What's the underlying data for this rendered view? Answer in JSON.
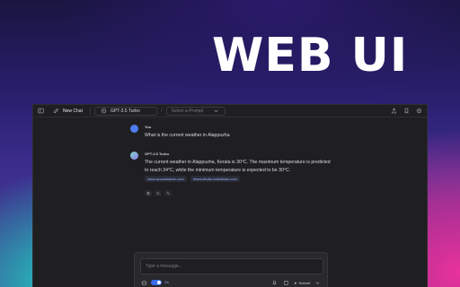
{
  "hero": {
    "title": "WEB UI"
  },
  "toolbar": {
    "new_chat_label": "New Chat",
    "model_label": "GPT-3.5 Turbo",
    "prompt_placeholder": "Select a Prompt"
  },
  "messages": [
    {
      "author": "You",
      "text": "What is the current weather in Alappuzha"
    },
    {
      "author": "GPT-3.5 Turbo",
      "text": "The current weather in Alappuzha, Kerala is 30°C. The maximum temperature is predicted to reach 34°C, while the minimum temperature is expected to be 30°C.",
      "sources": [
        "www.accuweather.com",
        "timesofindia.indiatimes.com"
      ]
    }
  ],
  "composer": {
    "placeholder": "Type a message...",
    "toggle_label": "On",
    "submit_label": "Submit"
  },
  "colors": {
    "accent": "#3b6cf0",
    "window_bg": "#1f1f21",
    "user_avatar": "#4f7cf0"
  }
}
